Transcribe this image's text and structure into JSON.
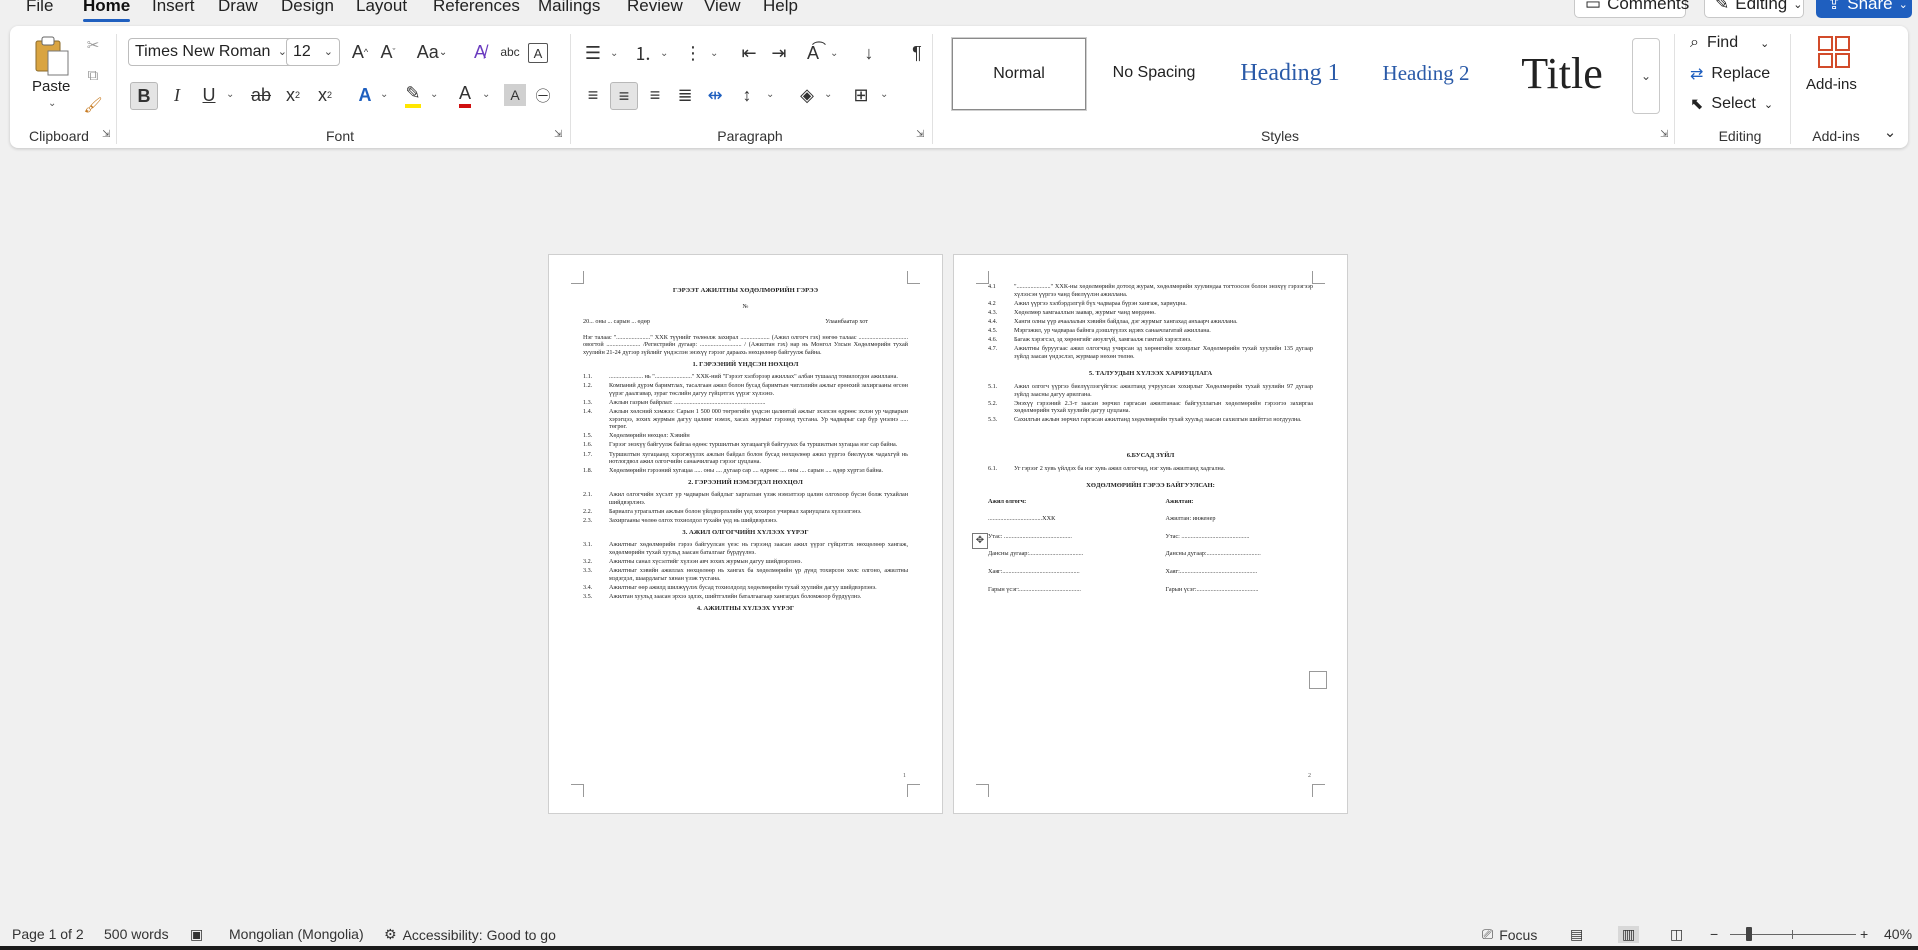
{
  "menu": {
    "tabs": [
      "File",
      "Home",
      "Insert",
      "Draw",
      "Design",
      "Layout",
      "References",
      "Mailings",
      "Review",
      "View",
      "Help"
    ],
    "active": "Home",
    "comments_label": "Comments",
    "editing_label": "Editing",
    "share_label": "Share"
  },
  "ribbon": {
    "clipboard": {
      "paste_label": "Paste",
      "group_label": "Clipboard"
    },
    "font": {
      "font_name": "Times New Roman",
      "font_size": "12",
      "group_label": "Font"
    },
    "paragraph": {
      "group_label": "Paragraph"
    },
    "styles": {
      "group_label": "Styles",
      "items": [
        "Normal",
        "No Spacing",
        "Heading 1",
        "Heading 2",
        "Title"
      ]
    },
    "editing": {
      "group_label": "Editing",
      "find_label": "Find",
      "replace_label": "Replace",
      "select_label": "Select"
    },
    "addins": {
      "label": "Add-ins",
      "group_label": "Add-ins"
    }
  },
  "document": {
    "page1": {
      "title": "ГЭРЭЭТ АЖИЛТНЫ ХӨДӨЛМӨРИЙН ГЭРЭЭ",
      "number_line": "№",
      "date_line": "20... оны ... сарын ... өдөр",
      "city": "Улаанбаатар хот",
      "intro": "Нэг талаас \"......................\" ХХК түүнийг төлөөлж захирал ................... (Ажил олгогч гэх) нөгөө талаас ................................ овогтой ...................... /Регистрийн дугаар: ........................... / (Ажилтан гэх) нар нь Монгол Улсын Хөдөлмөрийн тухай хуулийн 21-24 дүгээр зүйлийг үндэслэн энэхүү гэрээг дараахь нөхцөлөөр байгуулж байна.",
      "section1": "1. ГЭРЭЭНИЙ ҮНДСЭН НӨХЦӨЛ",
      "s1_items": [
        {
          "n": "1.1.",
          "t": "...................... нь \"........................\" ХХК-ний \"Гэрээт хэлбэрээр ажиллах\" албан тушаалд томилогдон ажиллана."
        },
        {
          "n": "1.2.",
          "t": "Компаний дүрэм баримтлах, тасалгаан ажил болон бусад баримтын чиглэлийн ажлыг ерөнхий захиргааны өгсөн үүрэг даалгавар, зураг төслийн дагуу гүйцэтгэх үүрэг хүлээнэ."
        },
        {
          "n": "1.3.",
          "t": "Ажлын газрын байрлал: ..........................................................."
        },
        {
          "n": "1.4.",
          "t": "Ажлын хөлсний хэмжээ: Сарын 1 500 000 төгрөгийн үндсэн цалинтай ажлыг эхэлсэн өдрөөс эхлэн ур чадварын хэрэгцээ, зохих журмын дагуу цалинг нэмэх, хасах журмыг гэрээнд тусгана. Ур чадварыг сар бүр үнэлнэ ..... төгрөг."
        },
        {
          "n": "1.5.",
          "t": "Хөдөлмөрийн нөхцөл: Хэвийн"
        },
        {
          "n": "1.6.",
          "t": "Гэрээг энэхүү байгуулж байгаа өдөөс туршилтын хугацаагүй байгуулах ба туршилтын хугацаа нэг сар байна."
        },
        {
          "n": "1.7.",
          "t": "Туршилтын хугацаанд хэрэгжүүлэх ажлын байдал болон бусад нөхцөлөөр ажил үүргээ биелүүлж чадахгүй нь нотлогдвол ажил олгогчийн санаачилгаар гэрээг цуцлана."
        },
        {
          "n": "1.8.",
          "t": "Хөдөлмөрийн гэрээний хугацаа ..... оны .... дугаар сар .... өдрөөс .... оны .... сарын .... өдөр хүртэл байна."
        }
      ],
      "section2": "2. ГЭРЭЭНИЙ НЭМЭГДЭЛ НӨХЦӨЛ",
      "s2_items": [
        {
          "n": "2.1.",
          "t": "Ажил олгогчийн хүсэлт ур чадварын байдлыг харгалзан үзэж нэмэлтээр цалин олгохоор бүсэн болж тухайлан шийдвэрлэнэ."
        },
        {
          "n": "2.2.",
          "t": "Бариалга уграгалтын ажлын болон үйлдвэрлэлийн үед хохирол учирвал хариуцлага хүлээлгэнэ."
        },
        {
          "n": "2.3.",
          "t": "Захиргааны чөлөө олгох тохиолдол тухайн үед нь шийдвэрлэнэ."
        }
      ],
      "section3": "3. АЖИЛ ОЛГОГЧИЙН ХҮЛЭЭХ ҮҮРЭГ",
      "s3_items": [
        {
          "n": "3.1.",
          "t": "Ажилтныг хөдөлмөрийн гэрээ байгуулсан үеэс нь гэрээнд заасан ажил үүрэг гүйцэтгэх нөхцөлөөр хангаж, хөдөлмөрийн тухай хуульд заасан баталгааг бүрдүүлнэ."
        },
        {
          "n": "3.2.",
          "t": "Ажилтны санал хүсэлтийг хүлээн авч зохих журмын дагуу шийдвэрлэнэ."
        },
        {
          "n": "3.3.",
          "t": "Ажилтныг хэвийн ажиллах нөхцөлөөр нь хангах ба хөдөлмөрийн үр дүнд тохирсон хөлс олгоно, ажилтны мэдэгдэл, шаардлагыг хянан үзэж тусгана."
        },
        {
          "n": "3.4.",
          "t": "Ажилтныг өөр ажилд шилжүүлэх бусад тохиолдолд хөдөлмөрийн тухай хуулийн дагуу шийдвэрлэнэ."
        },
        {
          "n": "3.5.",
          "t": "Ажилтан хуульд заасан эрхээ эдлэх, шийтгэлийн баталгаагаар хангагдах боломжоор бүрдүүлнэ."
        }
      ],
      "section4": "4. АЖИЛТНЫ ХҮЛЭЭХ ҮҮРЭГ",
      "page_number": "1"
    },
    "page2": {
      "items_top": [
        {
          "n": "4.1",
          "t": "\"......................\" ХХК-ны хөдөлмөрийн дотоод журам, хөдөлмөрийн хуулиндаа тогтоосон болон энэхүү гэрээгээр хүлээсэн үүргээ чанд биелүүлэн ажиллана."
        },
        {
          "n": "4.2",
          "t": "Ажил үүргээ хэлбэрдэлгүй бүх чадвараа бүрэн хангаж, хариуцна."
        },
        {
          "n": "4.3.",
          "t": "Хөдөлмөр хамгааллын заавар, журмыг чанд мөрдөнө."
        },
        {
          "n": "4.4.",
          "t": "Ханги олны үүр ачаалалын хэвийн байдлаа, дэг журмыг хангахад анхаарч ажиллана."
        },
        {
          "n": "4.5.",
          "t": "Мэргэжил, ур чадвараа байнга дээшлүүлэх идэвх санаачлагатай ажиллана."
        },
        {
          "n": "4.6.",
          "t": "Багаж хэрэгсэл, эд хөрөнгийг аюулгүй, хамгаалж гамтай хэрэглэнэ."
        },
        {
          "n": "4.7.",
          "t": "Ажилтны буруугаас ажил олгогчид учирсан эд хөрөнгийн хохирлыг Хөдөлмөрийн тухай хуулийн 135 дугаар зүйлд заасан үндэслэл, журмаар нөхөн төлнө."
        }
      ],
      "section5": "5. ТАЛУУДЫН ХҮЛЭЭХ ХАРИУЦЛАГА",
      "s5_items": [
        {
          "n": "5.1.",
          "t": "Ажил олгогч үүргээ биелүүлээгүйгээс ажилтанд учруулсан хохирлыг Хөдөлмөрийн тухай хуулийн 97 дугаар зүйлд заасны дагуу арилгана."
        },
        {
          "n": "5.2.",
          "t": "Энэхүү гэрээний 2.3-т заасан зөрчил гаргасан ажилтанаас байгууллагын хөдөлмөрийн гэрээгээ захиргаа хөдөлмөрийн тухай хуулийн дагуу цуцлана."
        },
        {
          "n": "5.3.",
          "t": "Сахилгын ажлын зөрчил гаргасан ажилтанд хөдөлмөрийн тухай хуульд заасан сахилгын шийтгэл ногдуулна."
        }
      ],
      "section6": "6.БУСАД ЗҮЙЛ",
      "s6_items": [
        {
          "n": "6.1.",
          "t": "Уг гэрээг 2 хувь үйлдэх ба нэг хувь ажил олгогчид, нэг хувь ажилтанд хадгална."
        }
      ],
      "signers_title": "ХӨДӨЛМӨРИЙН ГЭРЭЭ БАЙГУУЛСАН:",
      "left_col": [
        "Ажил олгогч:",
        "...................................ХХК",
        "Утас: ............................................",
        "Дансны дугаар:...................................",
        "Хаяг:..................................................",
        "Гарын үсэг:........................................"
      ],
      "right_col": [
        "Ажилтан:",
        "Ажилтан: инженер",
        "Утас: ............................................",
        "Дансны дугаар:...................................",
        "Хаяг:..................................................",
        "Гарын үсэг:........................................"
      ],
      "page_number": "2"
    }
  },
  "status": {
    "page": "Page 1 of 2",
    "words": "500 words",
    "language": "Mongolian (Mongolia)",
    "accessibility": "Accessibility: Good to go",
    "focus": "Focus",
    "zoom": "40%"
  }
}
